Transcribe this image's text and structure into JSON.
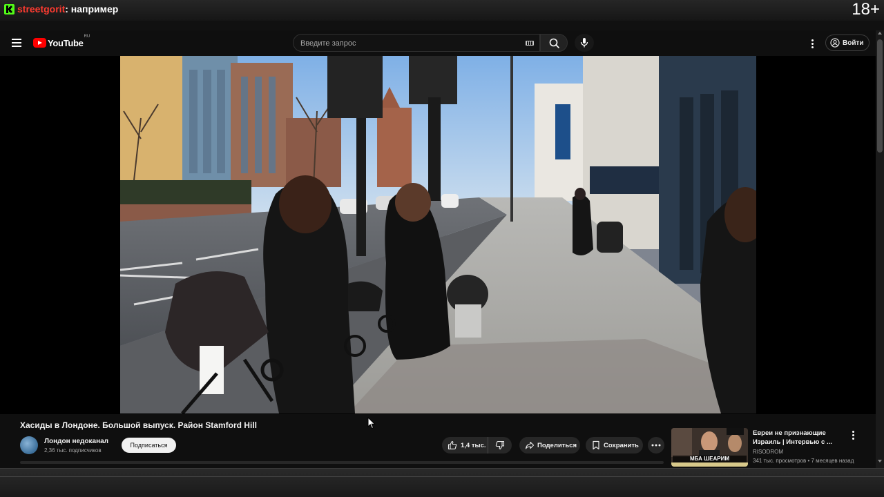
{
  "stream": {
    "channel": "streetgorit",
    "colon": ":",
    "status": " например",
    "age_rating": "18+"
  },
  "masthead": {
    "logo_text": "YouTube",
    "region": "RU",
    "search_placeholder": "Введите запрос",
    "signin_label": "Войти"
  },
  "video": {
    "title": "Хасиды в Лондоне. Большой выпуск. Район Stamford Hill",
    "channel_name": "Лондон недоканал",
    "subscribers": "2,36 тыс. подписчиков",
    "subscribe_label": "Подписаться",
    "like_count": "1,4 тыс.",
    "share_label": "Поделиться",
    "save_label": "Сохранить"
  },
  "recommendation": {
    "title": "Евреи не признающие Израиль | Интервью с ...",
    "channel": "RISODROM",
    "meta": "341 тыс. просмотров • 7 месяцев назад",
    "thumb_text": "МБА ШЕАРИМ"
  },
  "colors": {
    "youtube_red": "#ff0000",
    "kick_green": "#53fc18",
    "background": "#0f0f0f"
  },
  "icons": [
    "menu-icon",
    "youtube-logo-icon",
    "keyboard-icon",
    "search-icon",
    "mic-icon",
    "more-vert-icon",
    "account-icon",
    "thumb-up-icon",
    "thumb-down-icon",
    "share-icon",
    "bookmark-icon",
    "more-horiz-icon"
  ]
}
